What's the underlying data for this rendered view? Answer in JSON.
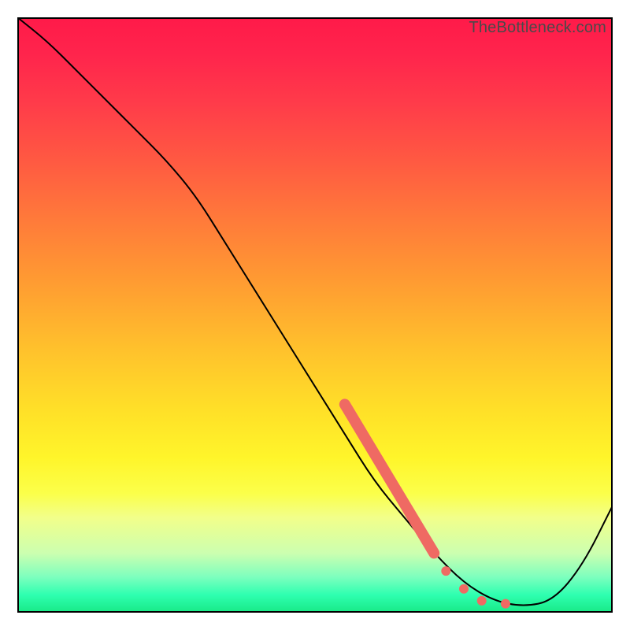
{
  "watermark": "TheBottleneck.com",
  "colors": {
    "gradient_top": "#ff1a49",
    "gradient_mid": "#ffe028",
    "gradient_bottom": "#18e986",
    "curve": "#000000",
    "markers": "#ef6a63"
  },
  "chart_data": {
    "type": "line",
    "title": "",
    "xlabel": "",
    "ylabel": "",
    "xlim": [
      0,
      100
    ],
    "ylim": [
      0,
      100
    ],
    "grid": false,
    "legend": false,
    "series": [
      {
        "name": "bottleneck-curve",
        "x": [
          0,
          5,
          10,
          15,
          20,
          25,
          30,
          35,
          40,
          45,
          50,
          55,
          60,
          65,
          70,
          75,
          80,
          85,
          90,
          95,
          100
        ],
        "y": [
          100,
          96,
          91,
          86,
          81,
          76,
          70,
          62,
          54,
          46,
          38,
          30,
          22,
          16,
          10,
          5,
          2,
          1,
          2,
          8,
          18
        ]
      }
    ],
    "markers": {
      "name": "data-cluster",
      "segment": {
        "x_start": 55,
        "y_start": 35,
        "x_end": 70,
        "y_end": 10
      },
      "points": [
        {
          "x": 72,
          "y": 7
        },
        {
          "x": 75,
          "y": 4
        },
        {
          "x": 78,
          "y": 2
        },
        {
          "x": 82,
          "y": 1.5
        }
      ]
    }
  }
}
